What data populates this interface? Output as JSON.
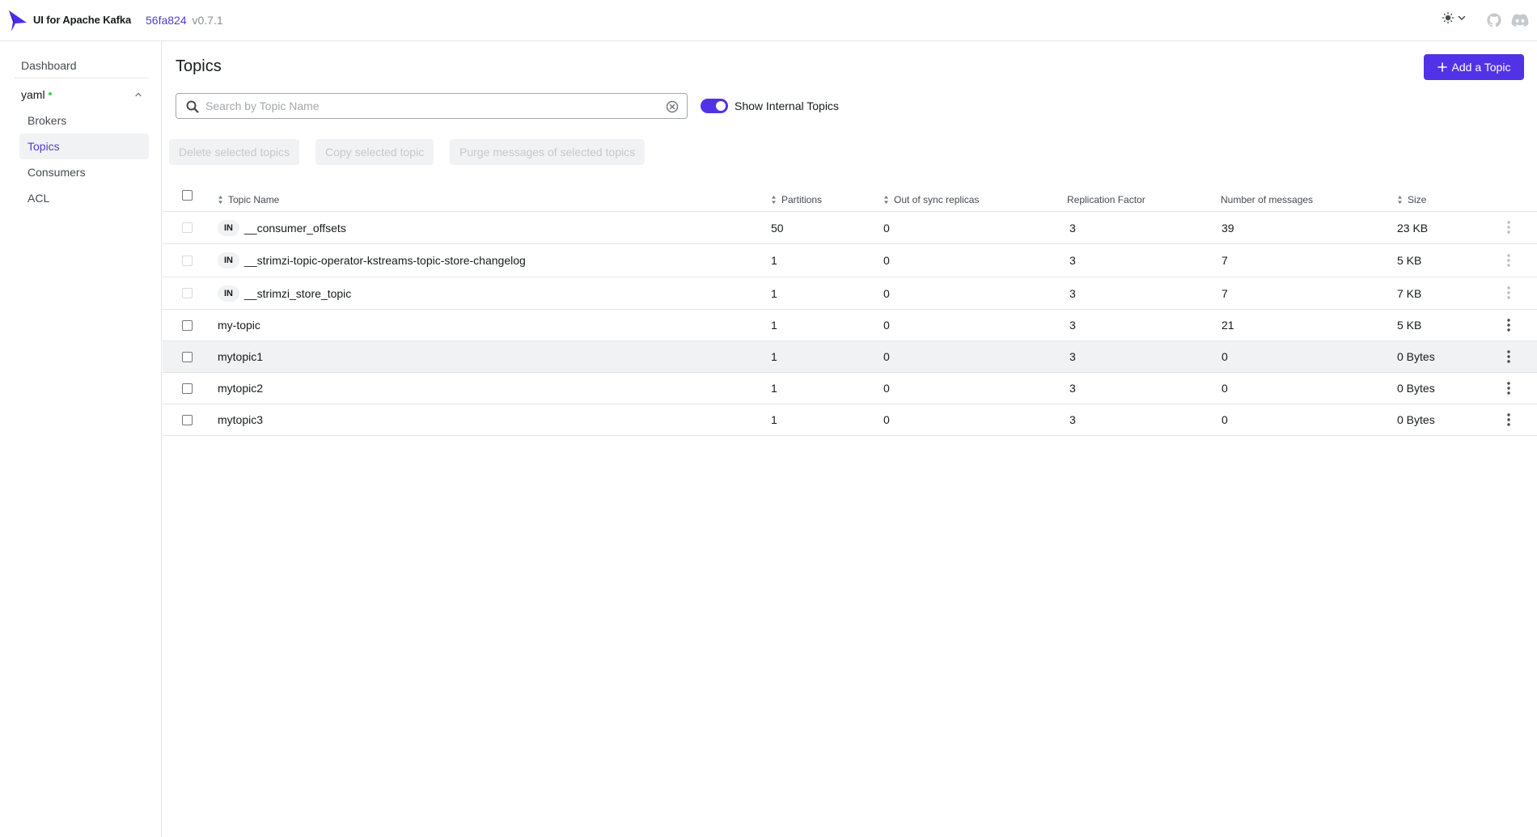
{
  "header": {
    "brand": "UI for Apache Kafka",
    "version_hash": "56fa824",
    "version_tag": "v0.7.1",
    "colors": {
      "accent": "#5232e6",
      "link": "#4c3fd1",
      "online_dot": "#3fcf62"
    }
  },
  "sidebar": {
    "dashboard": "Dashboard",
    "cluster": "yaml",
    "items": [
      {
        "label": "Brokers",
        "active": false
      },
      {
        "label": "Topics",
        "active": true
      },
      {
        "label": "Consumers",
        "active": false
      },
      {
        "label": "ACL",
        "active": false
      }
    ]
  },
  "main": {
    "title": "Topics",
    "add_button": "Add a Topic",
    "search_placeholder": "Search by Topic Name",
    "toggle_label": "Show Internal Topics",
    "toggle_on": true,
    "actions": {
      "delete": "Delete selected topics",
      "copy": "Copy selected topic",
      "purge": "Purge messages of selected topics"
    },
    "table": {
      "columns": {
        "name": "Topic Name",
        "partitions": "Partitions",
        "out_of_sync": "Out of sync replicas",
        "replication": "Replication Factor",
        "messages": "Number of messages",
        "size": "Size"
      },
      "internal_badge": "IN",
      "rows": [
        {
          "internal": true,
          "name": "__consumer_offsets",
          "partitions": "50",
          "out_of_sync": "0",
          "replication": "3",
          "messages": "39",
          "size": "23 KB"
        },
        {
          "internal": true,
          "name": "__strimzi-topic-operator-kstreams-topic-store-changelog",
          "partitions": "1",
          "out_of_sync": "0",
          "replication": "3",
          "messages": "7",
          "size": "5 KB"
        },
        {
          "internal": true,
          "name": "__strimzi_store_topic",
          "partitions": "1",
          "out_of_sync": "0",
          "replication": "3",
          "messages": "7",
          "size": "7 KB"
        },
        {
          "internal": false,
          "name": "my-topic",
          "partitions": "1",
          "out_of_sync": "0",
          "replication": "3",
          "messages": "21",
          "size": "5 KB"
        },
        {
          "internal": false,
          "name": "mytopic1",
          "partitions": "1",
          "out_of_sync": "0",
          "replication": "3",
          "messages": "0",
          "size": "0 Bytes",
          "hover": true
        },
        {
          "internal": false,
          "name": "mytopic2",
          "partitions": "1",
          "out_of_sync": "0",
          "replication": "3",
          "messages": "0",
          "size": "0 Bytes"
        },
        {
          "internal": false,
          "name": "mytopic3",
          "partitions": "1",
          "out_of_sync": "0",
          "replication": "3",
          "messages": "0",
          "size": "0 Bytes"
        }
      ]
    }
  }
}
